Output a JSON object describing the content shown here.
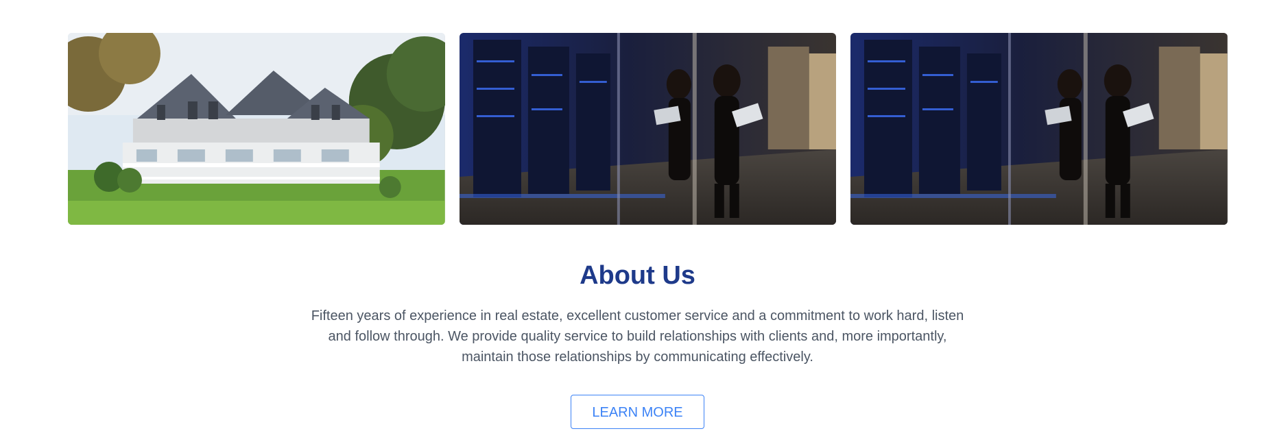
{
  "gallery": {
    "images": [
      {
        "icon": "house-photo"
      },
      {
        "icon": "server-room-photo"
      },
      {
        "icon": "server-room-photo"
      }
    ]
  },
  "about": {
    "title": "About Us",
    "body": "Fifteen years of experience in real estate, excellent customer service and a commitment to work hard, listen and follow through. We provide quality service to build relationships with clients and, more importantly, maintain those relationships by communicating effectively.",
    "button_label": "LEARN MORE"
  },
  "colors": {
    "heading": "#1e3a8a",
    "body_text": "#4b5563",
    "accent": "#3b82f6"
  }
}
